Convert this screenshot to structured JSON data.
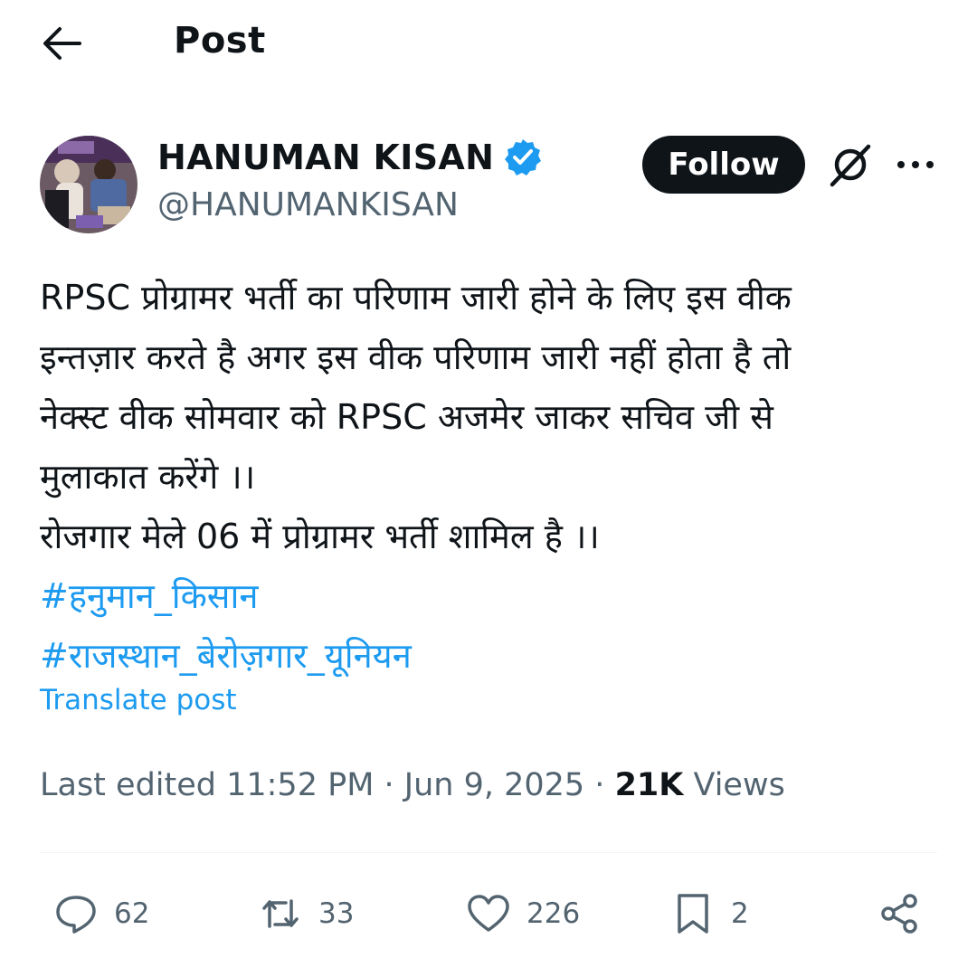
{
  "header": {
    "back_icon": "arrow-left-icon",
    "title": "Post"
  },
  "author": {
    "name": "HANUMAN KISAN",
    "handle": "@HANUMANKISAN",
    "verified_icon": "verified-badge-icon",
    "verified_color": "#1d9bf0"
  },
  "actions_top": {
    "follow_label": "Follow",
    "grok_icon": "grok-icon",
    "more_icon": "more-icon"
  },
  "post": {
    "lines": [
      "RPSC प्रोग्रामर भर्ती का परिणाम जारी होने के लिए इस वीक",
      "इन्तज़ार करते है अगर इस वीक परिणाम जारी नहीं होता है तो",
      "नेक्स्ट वीक सोमवार को RPSC अजमेर जाकर सचिव जी से",
      "मुलाकात करेंगे ।।",
      "रोजगार मेले 06 में प्रोग्रामर भर्ती शामिल है ।।"
    ],
    "hashtags": [
      "#हनुमान_किसान",
      "#राजस्थान_बेरोज़गार_यूनियन"
    ],
    "translate_label": "Translate post"
  },
  "meta": {
    "edited": "Last edited 11:52 PM · Jun 9, 2025 · ",
    "views_count": "21K",
    "views_label": " Views"
  },
  "stats": {
    "replies": "62",
    "reposts": "33",
    "likes": "226",
    "bookmarks": "2"
  },
  "colors": {
    "text": "#0f1419",
    "secondary": "#536471",
    "accent": "#1d9bf0"
  }
}
